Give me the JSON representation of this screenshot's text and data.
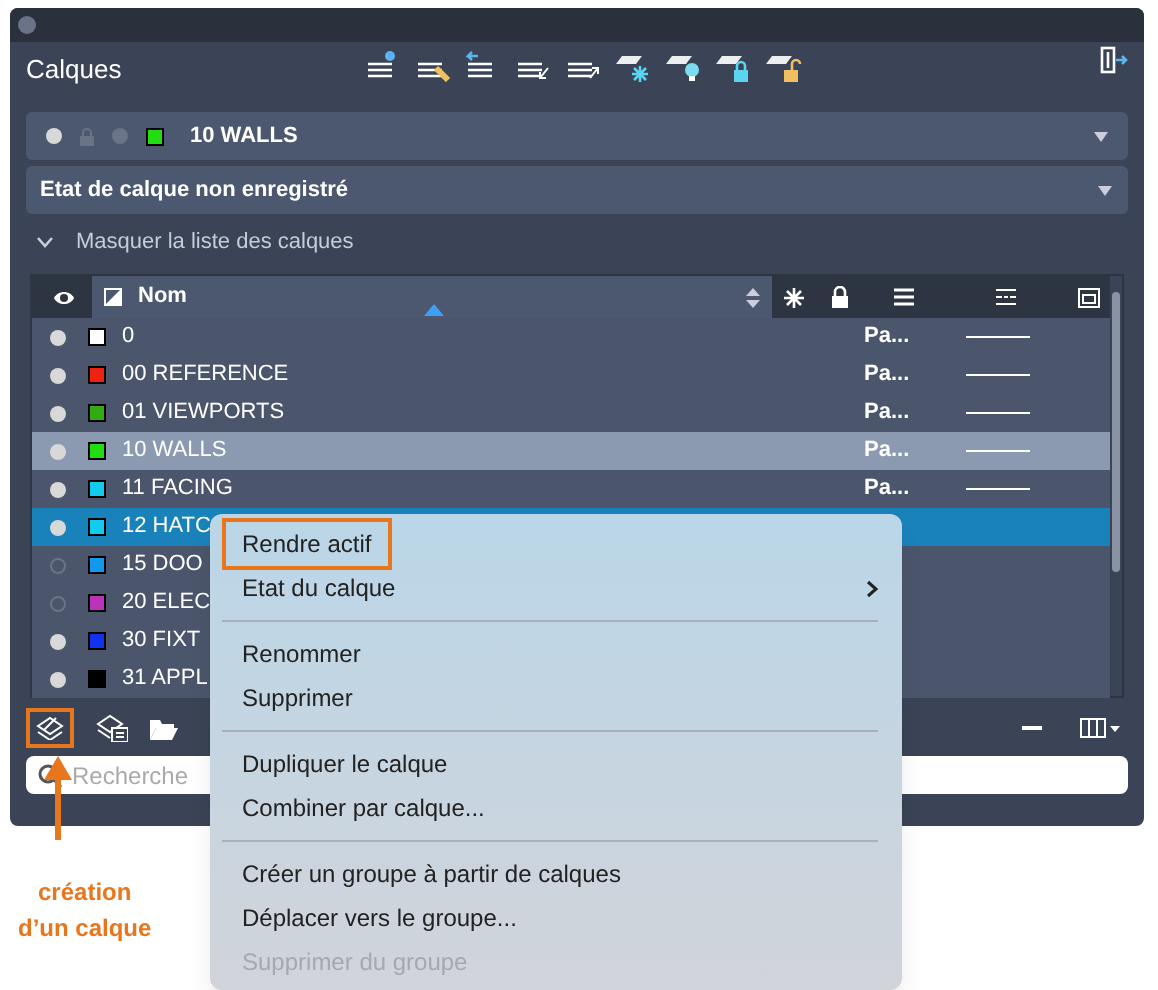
{
  "panel": {
    "title": "Calques"
  },
  "current_layer": {
    "name": "10 WALLS",
    "color": "#22dd11"
  },
  "layer_state": {
    "value": "Etat de calque non enregistré"
  },
  "toggle": {
    "label": "Masquer la liste des calques",
    "expanded": true
  },
  "table": {
    "columns": [
      {
        "label": "Nom"
      }
    ],
    "rows": [
      {
        "name": "0",
        "color": "#ffffff",
        "on": true,
        "plot_style": "Pa...",
        "selected": false
      },
      {
        "name": "00 REFERENCE",
        "color": "#ee2211",
        "on": true,
        "plot_style": "Pa...",
        "selected": false
      },
      {
        "name": "01 VIEWPORTS",
        "color": "#33aa11",
        "on": true,
        "plot_style": "Pa...",
        "selected": false
      },
      {
        "name": "10 WALLS",
        "color": "#22dd11",
        "on": true,
        "plot_style": "Pa...",
        "selected": true
      },
      {
        "name": "11 FACING",
        "color": "#11ccee",
        "on": true,
        "plot_style": "Pa...",
        "selected": false
      },
      {
        "name": "12 HATC",
        "color": "#11ccee",
        "on": true,
        "selected": true
      },
      {
        "name": "15 DOO",
        "color": "#1199ee",
        "on": false,
        "selected": false
      },
      {
        "name": "20 ELEC",
        "color": "#bb33bb",
        "on": false,
        "selected": false
      },
      {
        "name": "30 FIXT",
        "color": "#1133ee",
        "on": true,
        "selected": false
      },
      {
        "name": "31 APPL",
        "color": "#000000",
        "on": true,
        "selected": false
      }
    ]
  },
  "search": {
    "placeholder": "Recherche"
  },
  "context_menu": [
    {
      "kind": "item",
      "label": "Rendre actif",
      "highlighted": true
    },
    {
      "kind": "item",
      "label": "Etat du calque",
      "submenu": true
    },
    {
      "kind": "separator"
    },
    {
      "kind": "item",
      "label": "Renommer"
    },
    {
      "kind": "item",
      "label": "Supprimer"
    },
    {
      "kind": "separator"
    },
    {
      "kind": "item",
      "label": "Dupliquer le calque"
    },
    {
      "kind": "item",
      "label": "Combiner par calque..."
    },
    {
      "kind": "separator"
    },
    {
      "kind": "item",
      "label": "Créer un groupe à partir de calques"
    },
    {
      "kind": "item",
      "label": "Déplacer vers le groupe..."
    },
    {
      "kind": "item",
      "label": "Supprimer du groupe",
      "disabled": true
    }
  ],
  "annotation": {
    "lines": [
      "création",
      "d’un calque"
    ]
  }
}
